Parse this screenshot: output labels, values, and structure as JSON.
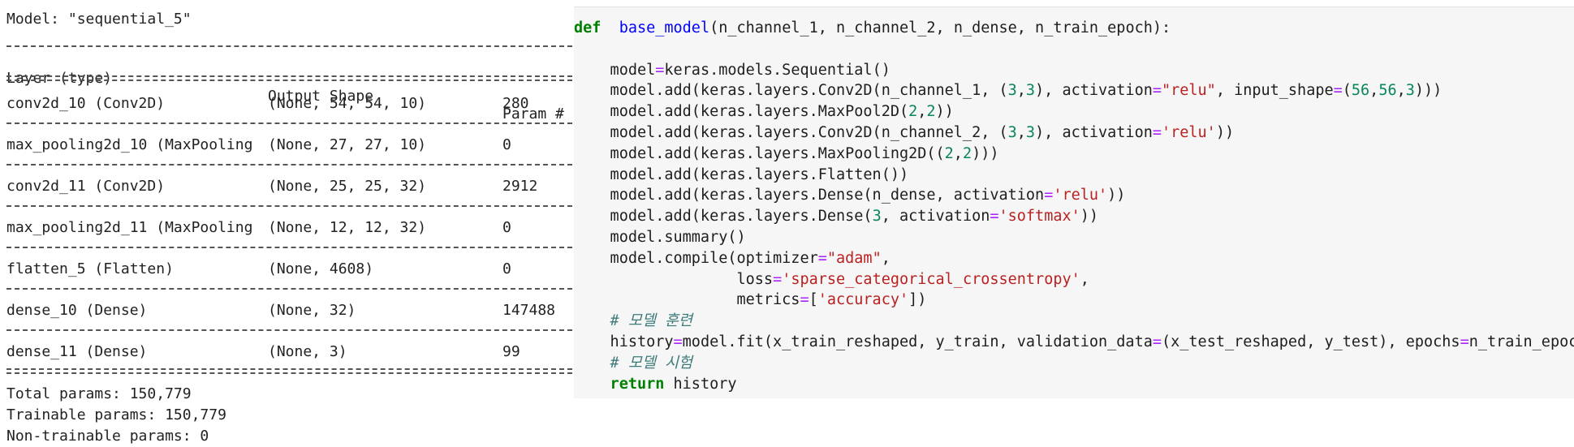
{
  "summary": {
    "model_header": "Model: \"sequential_5\"",
    "columns": [
      "Layer (type)",
      "Output Shape",
      "Param #"
    ],
    "rows": [
      {
        "layer": "conv2d_10 (Conv2D)",
        "shape": "(None, 54, 54, 10)",
        "params": "280"
      },
      {
        "layer": "max_pooling2d_10 (MaxPooling",
        "shape": "(None, 27, 27, 10)",
        "params": "0"
      },
      {
        "layer": "conv2d_11 (Conv2D)",
        "shape": "(None, 25, 25, 32)",
        "params": "2912"
      },
      {
        "layer": "max_pooling2d_11 (MaxPooling",
        "shape": "(None, 12, 12, 32)",
        "params": "0"
      },
      {
        "layer": "flatten_5 (Flatten)",
        "shape": "(None, 4608)",
        "params": "0"
      },
      {
        "layer": "dense_10 (Dense)",
        "shape": "(None, 32)",
        "params": "147488"
      },
      {
        "layer": "dense_11 (Dense)",
        "shape": "(None, 3)",
        "params": "99"
      }
    ],
    "total_params": "Total params: 150,779",
    "trainable_params": "Trainable params: 150,779",
    "non_trainable_params": "Non-trainable params: 0"
  },
  "code": {
    "lines": [
      [
        [
          "kw",
          "def"
        ],
        [
          "",
          "  "
        ],
        [
          "fn",
          "base_model"
        ],
        [
          "",
          "(n_channel_1, n_channel_2, n_dense, n_train_epoch):"
        ]
      ],
      [],
      [
        [
          "",
          "    model"
        ],
        [
          "op",
          "="
        ],
        [
          "",
          "keras.models.Sequential()"
        ]
      ],
      [
        [
          "",
          "    model.add(keras.layers.Conv2D(n_channel_1, ("
        ],
        [
          "num",
          "3"
        ],
        [
          "",
          ","
        ],
        [
          "num",
          "3"
        ],
        [
          "",
          "), activation"
        ],
        [
          "op",
          "="
        ],
        [
          "str",
          "\"relu\""
        ],
        [
          "",
          ", input_shape"
        ],
        [
          "op",
          "="
        ],
        [
          "",
          "("
        ],
        [
          "num",
          "56"
        ],
        [
          "",
          ","
        ],
        [
          "num",
          "56"
        ],
        [
          "",
          ","
        ],
        [
          "num",
          "3"
        ],
        [
          "",
          ")))"
        ]
      ],
      [
        [
          "",
          "    model.add(keras.layers.MaxPool2D("
        ],
        [
          "num",
          "2"
        ],
        [
          "",
          ","
        ],
        [
          "num",
          "2"
        ],
        [
          "",
          "))"
        ]
      ],
      [
        [
          "",
          "    model.add(keras.layers.Conv2D(n_channel_2, ("
        ],
        [
          "num",
          "3"
        ],
        [
          "",
          ","
        ],
        [
          "num",
          "3"
        ],
        [
          "",
          "), activation"
        ],
        [
          "op",
          "="
        ],
        [
          "str",
          "'relu'"
        ],
        [
          "",
          "))"
        ]
      ],
      [
        [
          "",
          "    model.add(keras.layers.MaxPooling2D(("
        ],
        [
          "num",
          "2"
        ],
        [
          "",
          ","
        ],
        [
          "num",
          "2"
        ],
        [
          "",
          ")))"
        ]
      ],
      [
        [
          "",
          "    model.add(keras.layers.Flatten())"
        ]
      ],
      [
        [
          "",
          "    model.add(keras.layers.Dense(n_dense, activation"
        ],
        [
          "op",
          "="
        ],
        [
          "str",
          "'relu'"
        ],
        [
          "",
          "))"
        ]
      ],
      [
        [
          "",
          "    model.add(keras.layers.Dense("
        ],
        [
          "num",
          "3"
        ],
        [
          "",
          ", activation"
        ],
        [
          "op",
          "="
        ],
        [
          "str",
          "'softmax'"
        ],
        [
          "",
          "))"
        ]
      ],
      [
        [
          "",
          "    model.summary()"
        ]
      ],
      [
        [
          "",
          "    model.compile(optimizer"
        ],
        [
          "op",
          "="
        ],
        [
          "str",
          "\"adam\""
        ],
        [
          "",
          ","
        ]
      ],
      [
        [
          "",
          "                  loss"
        ],
        [
          "op",
          "="
        ],
        [
          "str",
          "'sparse_categorical_crossentropy'"
        ],
        [
          "",
          ","
        ]
      ],
      [
        [
          "",
          "                  metrics"
        ],
        [
          "op",
          "="
        ],
        [
          "",
          "["
        ],
        [
          "str",
          "'accuracy'"
        ],
        [
          "",
          "])"
        ]
      ],
      [
        [
          "cmt",
          "    # 모델 훈련"
        ]
      ],
      [
        [
          "",
          "    history"
        ],
        [
          "op",
          "="
        ],
        [
          "",
          "model.fit(x_train_reshaped, y_train, validation_data"
        ],
        [
          "op",
          "="
        ],
        [
          "",
          "(x_test_reshaped, y_test), epochs"
        ],
        [
          "op",
          "="
        ],
        [
          "",
          "n_train_epoch)"
        ]
      ],
      [
        [
          "cmt",
          "    # 모델 시험"
        ]
      ],
      [
        [
          "kw",
          "    return"
        ],
        [
          "",
          " history"
        ]
      ]
    ]
  }
}
